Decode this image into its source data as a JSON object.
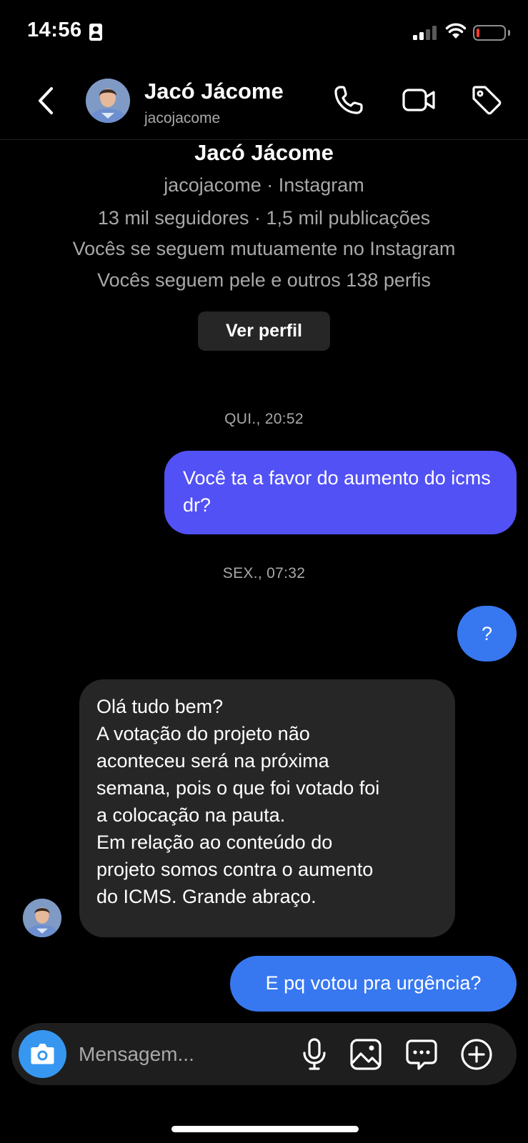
{
  "status_bar": {
    "time": "14:56",
    "battery_level_percent": 10,
    "battery_color": "#ff3b30"
  },
  "header": {
    "name": "Jacó Jácome",
    "username": "jacojacome",
    "icons": [
      "chevron-left-icon",
      "phone-icon",
      "video-camera-icon",
      "tag-icon"
    ]
  },
  "profile_summary": {
    "name": "Jacó Jácome",
    "handle_line": "jacojacome · Instagram",
    "stats_line": "13 mil seguidores · 1,5 mil publicações",
    "mutual_line": "Vocês se seguem mutuamente no Instagram",
    "follow_line": "Vocês seguem pele e outros 138 perfis",
    "view_profile_label": "Ver perfil"
  },
  "messages": {
    "timestamp_1": "QUI., 20:52",
    "msg_1": "Você ta a favor do aumento do icms dr?",
    "timestamp_2": "SEX., 07:32",
    "msg_2": "?",
    "msg_3_lines": [
      "Olá tudo bem?",
      "A votação do projeto não",
      "aconteceu será na próxima",
      "semana, pois o que foi votado foi",
      "a colocação na pauta.",
      "Em relação ao conteúdo do",
      "projeto somos contra o aumento",
      "do ICMS. Grande abraço."
    ],
    "msg_4": "E pq votou pra urgência?"
  },
  "composer": {
    "placeholder": "Mensagem...",
    "icons": [
      "camera-icon",
      "microphone-icon",
      "gallery-icon",
      "sticker-icon",
      "plus-circle-icon"
    ]
  },
  "colors": {
    "background": "#000000",
    "outgoing_bubble_purple": "#5251f5",
    "outgoing_bubble_blue": "#3778f0",
    "incoming_bubble": "#262626",
    "camera_button": "#3797f0",
    "secondary_text": "#a8a8a8"
  }
}
